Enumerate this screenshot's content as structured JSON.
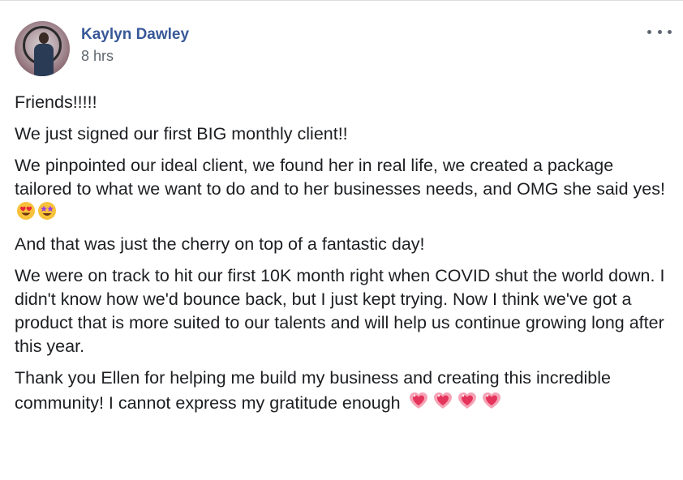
{
  "post": {
    "author": "Kaylyn Dawley",
    "timestamp": "8 hrs",
    "paragraphs": [
      "Friends!!!!!",
      "We just signed our first BIG monthly client!!",
      "We pinpointed our ideal client, we found her in real life, we created a package tailored to what we want to do and to her businesses needs, and OMG she said yes!",
      "And that was just the cherry on top of a fantastic day!",
      "We were on track to hit our first 10K month right when COVID shut the world down. I didn't know how we'd bounce back, but I just kept trying. Now I think we've got a product that is more suited to our talents and will help us continue growing long after this year.",
      "Thank you Ellen for helping me build my business and creating this incredible community! I cannot express my gratitude enough"
    ],
    "emojis": {
      "p3": [
        "heart-eyes-emoji",
        "star-struck-emoji"
      ],
      "p6": [
        "sparkling-heart-emoji",
        "sparkling-heart-emoji",
        "sparkling-heart-emoji",
        "sparkling-heart-emoji"
      ]
    },
    "colors": {
      "author": "#385898",
      "timestamp": "#606770",
      "text": "#1c1e21"
    }
  }
}
